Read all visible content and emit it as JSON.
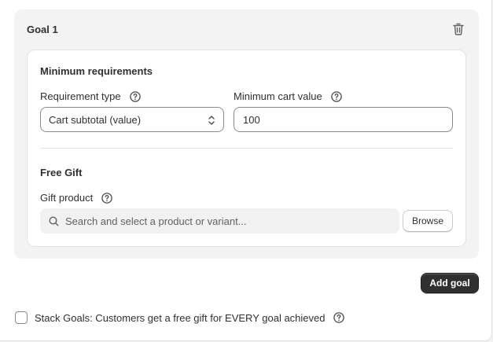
{
  "goal": {
    "title": "Goal 1",
    "delete_icon": "trash-icon"
  },
  "min_requirements": {
    "title": "Minimum requirements",
    "requirement_type_label": "Requirement type",
    "requirement_type_value": "Cart subtotal (value)",
    "min_cart_label": "Minimum cart value",
    "min_cart_value": "100"
  },
  "free_gift": {
    "title": "Free Gift",
    "gift_product_label": "Gift product",
    "search_placeholder": "Search and select a product or variant...",
    "browse_label": "Browse"
  },
  "actions": {
    "add_goal_label": "Add goal"
  },
  "stack": {
    "label": "Stack Goals: Customers get a free gift for EVERY goal achieved",
    "checked": false
  },
  "icons": {
    "help": "question-circle-icon",
    "search": "search-icon",
    "select": "chevron-up-down-icon"
  },
  "colors": {
    "primary_button": "#303030",
    "text": "#303030",
    "border": "#8a8a8a",
    "card_bg": "#f3f3f3"
  }
}
